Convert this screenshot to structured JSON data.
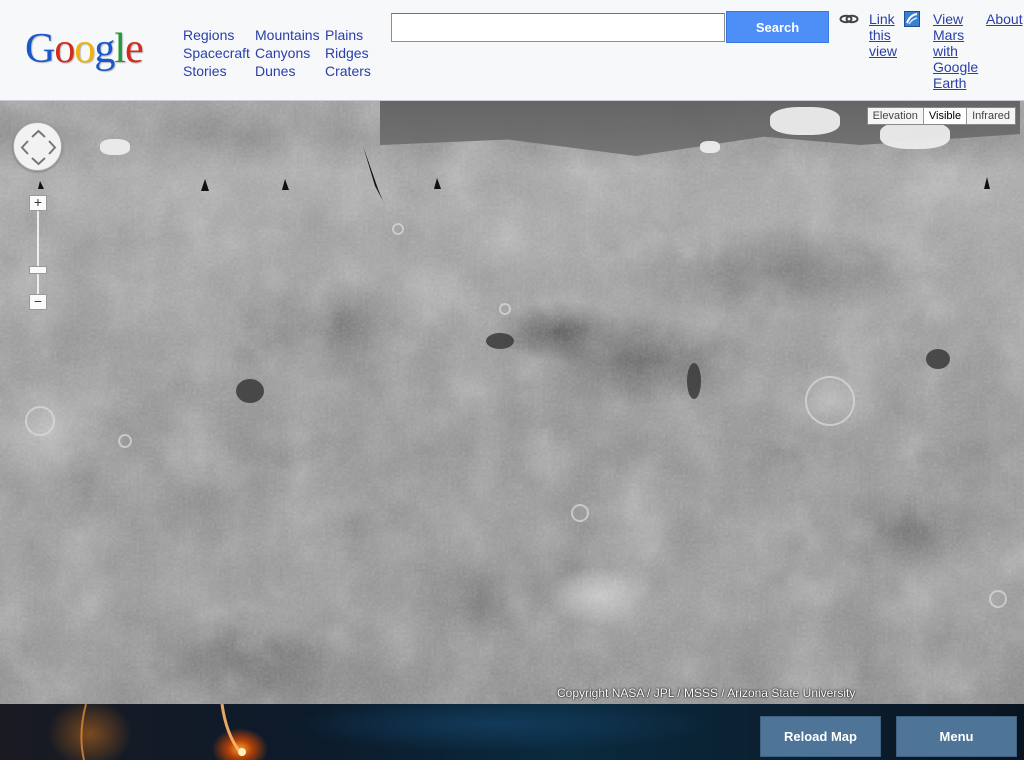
{
  "header": {
    "logo_letters": [
      {
        "char": "G",
        "color": "#1a57c8"
      },
      {
        "char": "o",
        "color": "#d42a1d"
      },
      {
        "char": "o",
        "color": "#f1b10d"
      },
      {
        "char": "g",
        "color": "#1a57c8"
      },
      {
        "char": "l",
        "color": "#1f9a37"
      },
      {
        "char": "e",
        "color": "#d42a1d"
      }
    ],
    "nav_columns": [
      [
        "Regions",
        "Spacecraft",
        "Stories"
      ],
      [
        "Mountains",
        "Canyons",
        "Dunes"
      ],
      [
        "Plains",
        "Ridges",
        "Craters"
      ]
    ],
    "search": {
      "value": "",
      "button_label": "Search"
    },
    "link_view": {
      "label": "Link this view",
      "icon": "chain-link-icon"
    },
    "google_earth": {
      "label": "View Mars with Google Earth",
      "icon": "google-earth-icon"
    },
    "about_label": "About"
  },
  "map": {
    "layers": [
      "Elevation",
      "Visible",
      "Infrared"
    ],
    "active_layer": "Visible",
    "zoom_in_label": "+",
    "zoom_out_label": "−",
    "copyright": "Copyright NASA / JPL / MSSS / Arizona State University"
  },
  "footer": {
    "reload_label": "Reload Map",
    "menu_label": "Menu"
  },
  "colors": {
    "link": "#2a3fa8",
    "search_button": "#4d8ef7",
    "footer_button": "#4e7597"
  }
}
